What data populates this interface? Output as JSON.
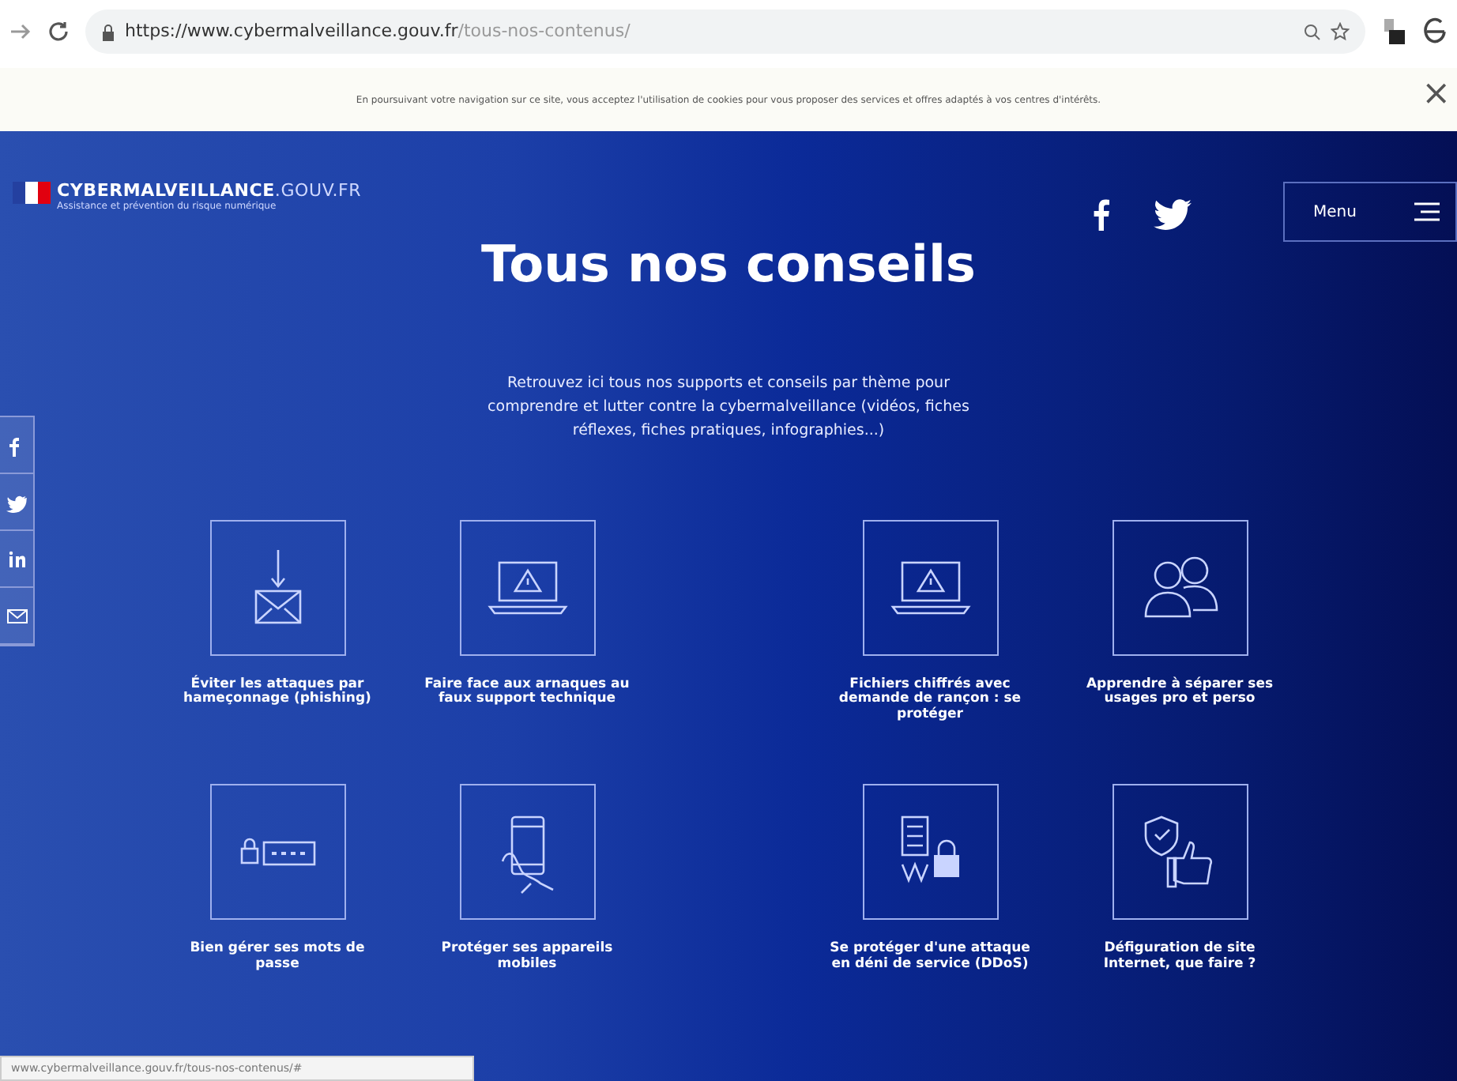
{
  "browser": {
    "url_host": "https://www.cybermalveillance.gouv.fr",
    "url_path": "/tous-nos-contenus/"
  },
  "cookie_banner": {
    "text": "En poursuivant votre navigation sur ce site, vous acceptez l'utilisation de cookies pour vous proposer des services et offres adaptés à vos centres d'intérêts.",
    "close": "×"
  },
  "header": {
    "logo_title": "CYBERMALVEILLANCE",
    "logo_domain": ".GOUV.FR",
    "logo_subtitle": "Assistance et prévention du risque numérique",
    "menu": "Menu"
  },
  "title": "Tous nos conseils",
  "intro": "Retrouvez ici tous nos supports et conseils par thème pour comprendre et lutter contre la cybermalveillance (vidéos, fiches réflexes, fiches pratiques, infographies...)",
  "share_bar": {
    "items": [
      {
        "kind": "facebook"
      },
      {
        "kind": "twitter"
      },
      {
        "kind": "linkedin"
      },
      {
        "kind": "mail"
      }
    ]
  },
  "tiles": [
    {
      "kind": "mail-hook",
      "label": "Éviter les attaques par hameçonnage (phishing)"
    },
    {
      "kind": "laptop-warning",
      "label": "Faire face aux arnaques au faux support technique"
    },
    {
      "kind": "laptop-warning",
      "label": "Fichiers chiffrés avec demande de rançon : se protéger"
    },
    {
      "kind": "people",
      "label": "Apprendre à séparer ses usages pro et perso"
    },
    {
      "kind": "password",
      "label": "Bien gérer ses mots de passe"
    },
    {
      "kind": "phone",
      "label": "Protéger ses appareils mobiles"
    },
    {
      "kind": "server-lock",
      "label": "Se protéger d'une attaque en déni de service (DDoS)"
    },
    {
      "kind": "thumb-shield",
      "label": "Défiguration de site Internet, que faire ?"
    }
  ],
  "status_bar": {
    "url": "www.cybermalveillance.gouv.fr/tous-nos-contenus/#"
  }
}
